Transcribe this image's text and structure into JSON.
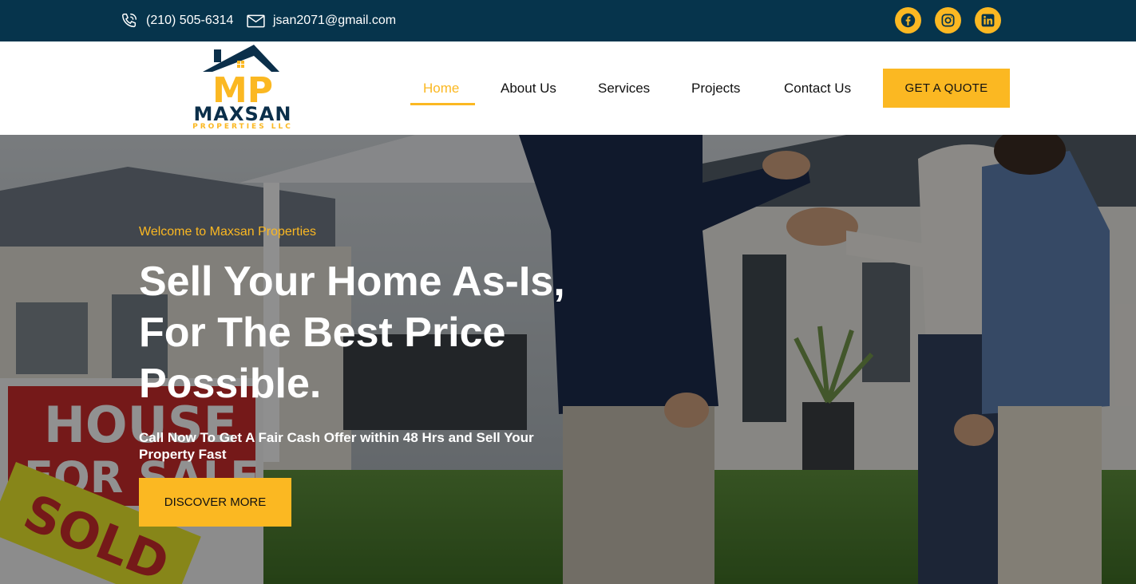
{
  "topbar": {
    "phone": "(210) 505-6314",
    "email": "jsan2071@gmail.com",
    "social": [
      {
        "icon": "facebook-icon"
      },
      {
        "icon": "instagram-icon"
      },
      {
        "icon": "linkedin-icon"
      }
    ]
  },
  "logo": {
    "brand": "MAXSAN",
    "sub": "PROPERTIES LLC",
    "monogram": "MP"
  },
  "nav": {
    "items": [
      {
        "label": "Home",
        "active": true
      },
      {
        "label": "About Us",
        "active": false
      },
      {
        "label": "Services",
        "active": false
      },
      {
        "label": "Projects",
        "active": false
      },
      {
        "label": "Contact Us",
        "active": false
      }
    ],
    "quote_label": "GET A QUOTE"
  },
  "hero": {
    "eyebrow": "Welcome to Maxsan Properties",
    "headline_lines": [
      "Sell Your Home As-Is,",
      "For The Best Price",
      "Possible."
    ],
    "subline": "Call Now To Get A Fair Cash Offer within 48 Hrs and Sell Your Property Fast",
    "cta_label": "DISCOVER MORE",
    "sign_line1": "HOUSE",
    "sign_line2": "FOR SALE",
    "sold": "SOLD"
  },
  "colors": {
    "topbar_bg": "#06344c",
    "accent": "#fbb822",
    "brand_navy": "#0b2f4a"
  }
}
